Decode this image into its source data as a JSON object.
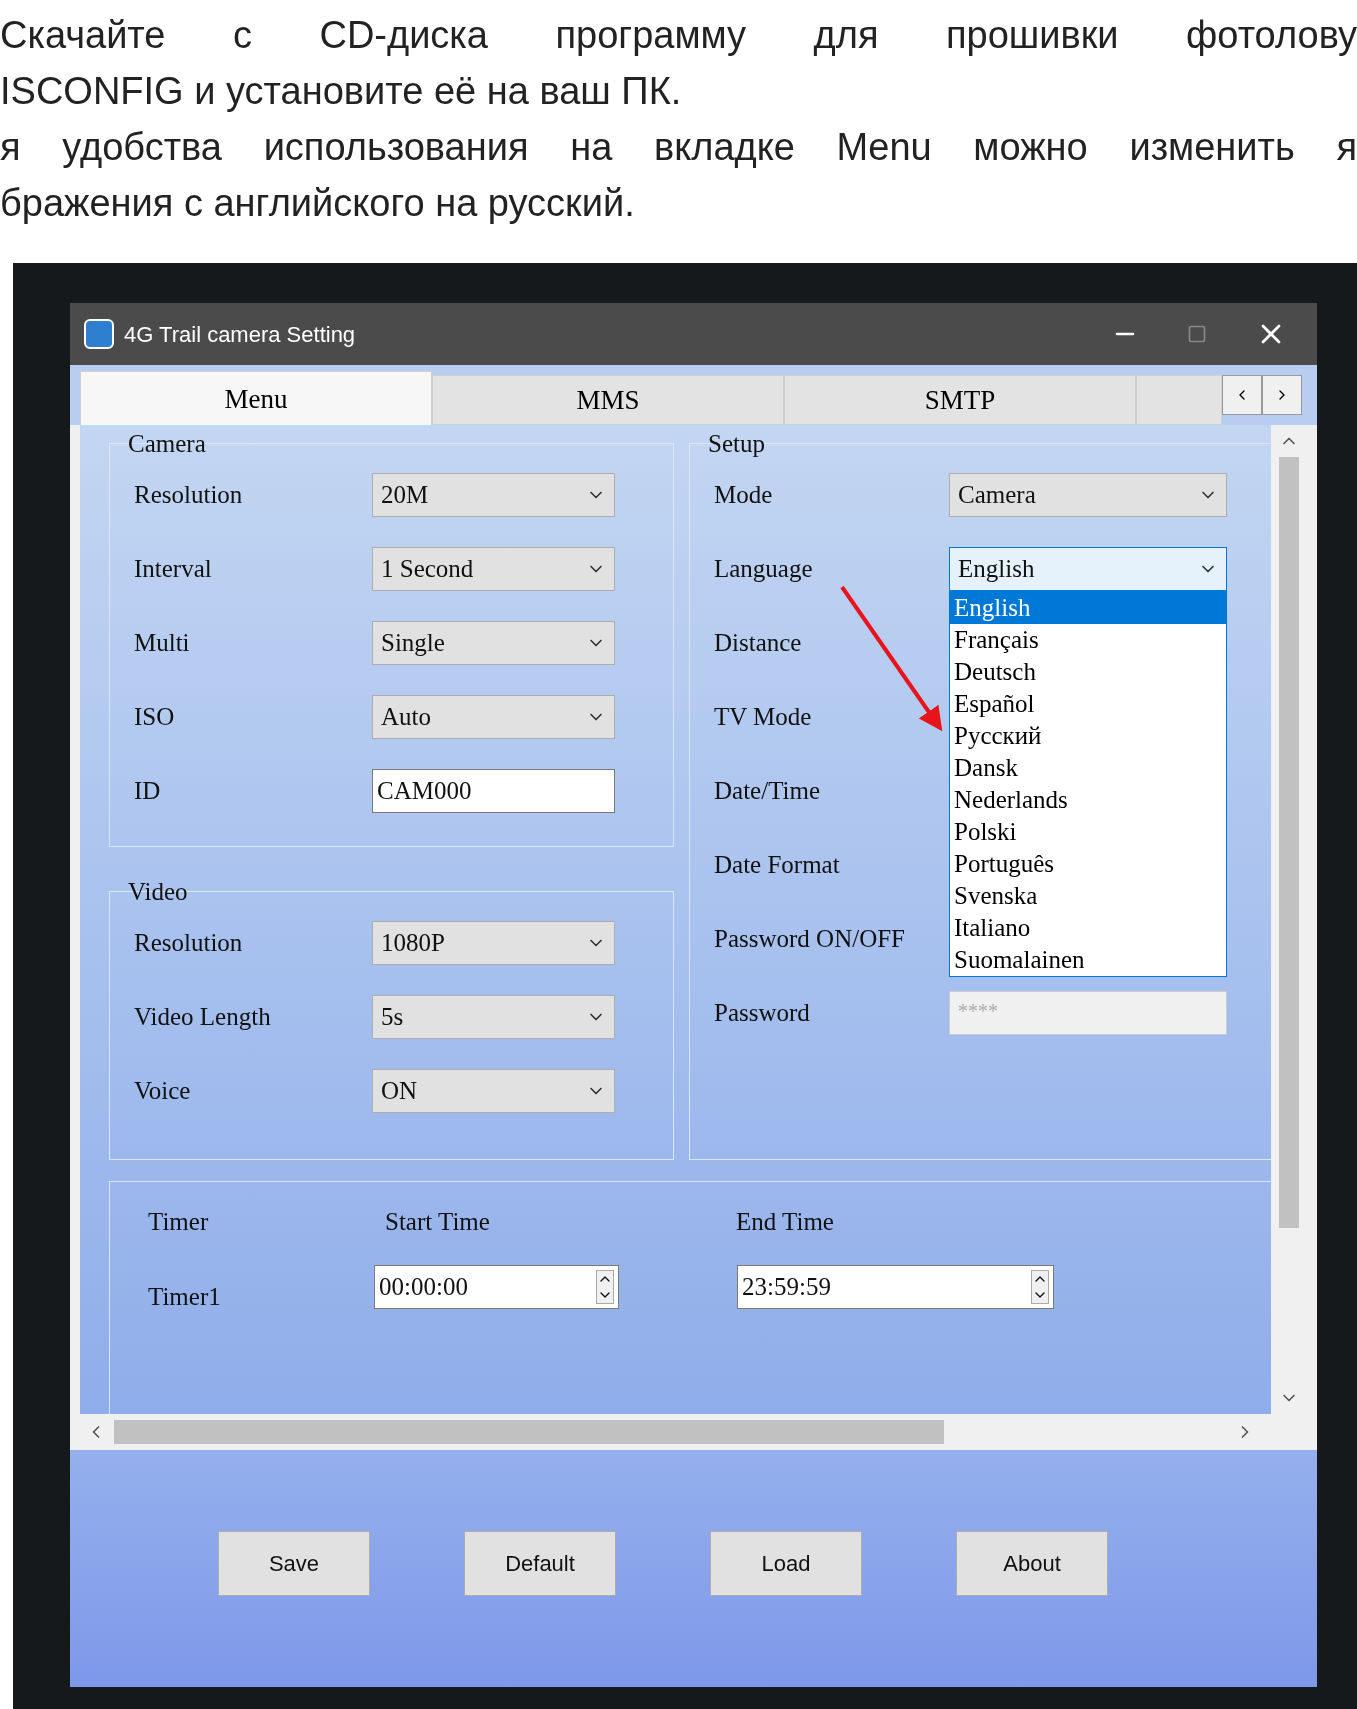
{
  "instructions": [
    "Скачайте с CD-диска программу для прошивки фотолову",
    "ISCONFIG и установите её на ваш ПК.",
    "я удобства использования на вкладке Menu можно изменить я",
    "бражения с английского на русский."
  ],
  "window": {
    "title": "4G Trail camera Setting"
  },
  "tabs": [
    {
      "label": "Menu",
      "selected": true
    },
    {
      "label": "MMS",
      "selected": false
    },
    {
      "label": "SMTP",
      "selected": false
    }
  ],
  "camera": {
    "title": "Camera",
    "fields": [
      {
        "label": "Resolution",
        "kind": "dropdown",
        "value": "20M"
      },
      {
        "label": "Interval",
        "kind": "dropdown",
        "value": "1 Second"
      },
      {
        "label": "Multi",
        "kind": "dropdown",
        "value": "Single"
      },
      {
        "label": "ISO",
        "kind": "dropdown",
        "value": "Auto"
      },
      {
        "label": "ID",
        "kind": "text",
        "value": "CAM000"
      }
    ]
  },
  "video": {
    "title": "Video",
    "fields": [
      {
        "label": "Resolution",
        "kind": "dropdown",
        "value": "1080P"
      },
      {
        "label": "Video Length",
        "kind": "dropdown",
        "value": "5s"
      },
      {
        "label": "Voice",
        "kind": "dropdown",
        "value": "ON"
      }
    ]
  },
  "setup": {
    "title": "Setup",
    "fields": [
      {
        "label": "Mode",
        "kind": "dropdown",
        "value": "Camera"
      },
      {
        "label": "Language",
        "kind": "dropdown",
        "value": "English",
        "expanded": true
      },
      {
        "label": "Distance",
        "kind": "covered"
      },
      {
        "label": "TV Mode",
        "kind": "covered"
      },
      {
        "label": "Date/Time",
        "kind": "covered"
      },
      {
        "label": "Date Format",
        "kind": "covered"
      },
      {
        "label": "Password ON/OFF",
        "kind": "covered"
      },
      {
        "label": "Password",
        "kind": "password",
        "value": "****"
      }
    ]
  },
  "language_options": [
    {
      "label": "English",
      "selected": true
    },
    {
      "label": "Français",
      "selected": false
    },
    {
      "label": "Deutsch",
      "selected": false
    },
    {
      "label": "Español",
      "selected": false
    },
    {
      "label": "Русский",
      "selected": false
    },
    {
      "label": "Dansk",
      "selected": false
    },
    {
      "label": "Nederlands",
      "selected": false
    },
    {
      "label": "Polski",
      "selected": false
    },
    {
      "label": "Português",
      "selected": false
    },
    {
      "label": "Svenska",
      "selected": false
    },
    {
      "label": "Italiano",
      "selected": false
    },
    {
      "label": "Suomalainen",
      "selected": false
    }
  ],
  "timer": {
    "title": "Timer",
    "start_heading": "Start Time",
    "end_heading": "End Time",
    "rows": [
      {
        "label": "Timer1",
        "start": "00:00:00",
        "end": "23:59:59"
      }
    ]
  },
  "buttons": [
    "Save",
    "Default",
    "Load",
    "About"
  ]
}
